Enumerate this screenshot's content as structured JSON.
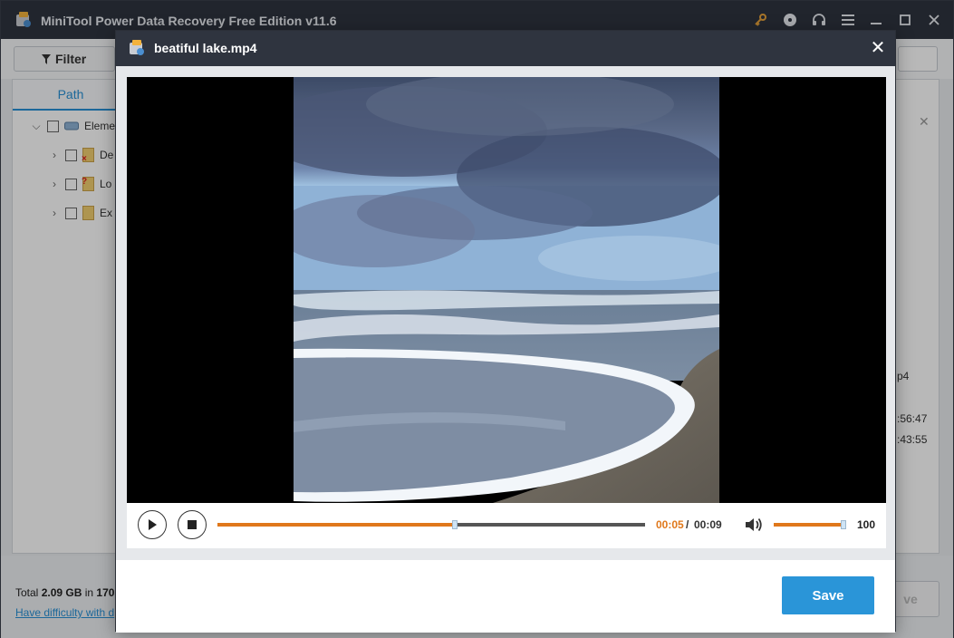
{
  "app": {
    "title": "MiniTool Power Data Recovery Free Edition v11.6",
    "icons": [
      "key-icon",
      "disc-icon",
      "headset-icon",
      "menu-icon",
      "minimize-icon",
      "maximize-icon",
      "close-icon"
    ]
  },
  "toolbar": {
    "filter_label": "Filter"
  },
  "tree": {
    "tab_label": "Path",
    "items": [
      {
        "label": "Eleme",
        "icon": "drive-icon"
      },
      {
        "label": "De",
        "icon": "deleted-folder-icon"
      },
      {
        "label": "Lo",
        "icon": "lost-folder-icon"
      },
      {
        "label": "Ex",
        "icon": "folder-icon"
      }
    ]
  },
  "details_fragments": {
    "name": "p4",
    "time1": ":56:47",
    "time2": ":43:55"
  },
  "footer": {
    "total_prefix": "Total ",
    "total_size": "2.09 GB",
    "total_mid": " in ",
    "total_count": "170",
    "help_link": "Have difficulty with d",
    "save_label": "ve"
  },
  "dialog": {
    "title": "beatiful lake.mp4",
    "close_symbol": "✕",
    "player": {
      "current_time": "00:05",
      "separator": "/",
      "total_time": "00:09",
      "progress": 0.555,
      "volume": "100",
      "volume_level": 1.0
    },
    "save_label": "Save"
  },
  "colors": {
    "accent": "#e0781b",
    "primary": "#2a95d8",
    "titlebar": "#2f343f"
  }
}
